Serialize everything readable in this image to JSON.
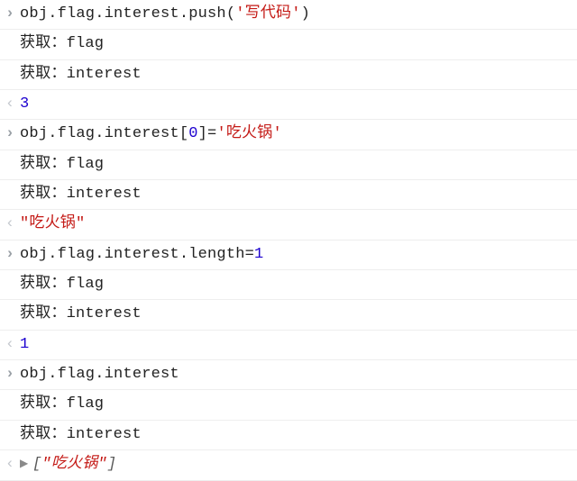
{
  "session": [
    {
      "input": {
        "parts": [
          {
            "t": "obj.flag.interest.push(",
            "cls": "tok-obj"
          },
          {
            "t": "'写代码'",
            "cls": "tok-str"
          },
          {
            "t": ")",
            "cls": "tok-obj"
          }
        ]
      },
      "logs": [
        "获取：flag",
        "获取：interest"
      ],
      "result": {
        "kind": "number",
        "text": "3"
      }
    },
    {
      "input": {
        "parts": [
          {
            "t": "obj.flag.interest[",
            "cls": "tok-obj"
          },
          {
            "t": "0",
            "cls": "tok-num"
          },
          {
            "t": "]=",
            "cls": "tok-obj"
          },
          {
            "t": "'吃火锅'",
            "cls": "tok-str"
          }
        ]
      },
      "logs": [
        "获取：flag",
        "获取：interest"
      ],
      "result": {
        "kind": "string",
        "text": "\"吃火锅\""
      }
    },
    {
      "input": {
        "parts": [
          {
            "t": "obj.flag.interest.length=",
            "cls": "tok-obj"
          },
          {
            "t": "1",
            "cls": "tok-num"
          }
        ]
      },
      "logs": [
        "获取：flag",
        "获取：interest"
      ],
      "result": {
        "kind": "number",
        "text": "1"
      }
    },
    {
      "input": {
        "parts": [
          {
            "t": "obj.flag.interest",
            "cls": "tok-obj"
          }
        ]
      },
      "logs": [
        "获取：flag",
        "获取：interest"
      ],
      "result": {
        "kind": "array",
        "prefix": "[",
        "value": "\"吃火锅\"",
        "suffix": "]"
      }
    }
  ],
  "prompt_in": "›",
  "prompt_out": "‹",
  "disclose_glyph": "▶"
}
